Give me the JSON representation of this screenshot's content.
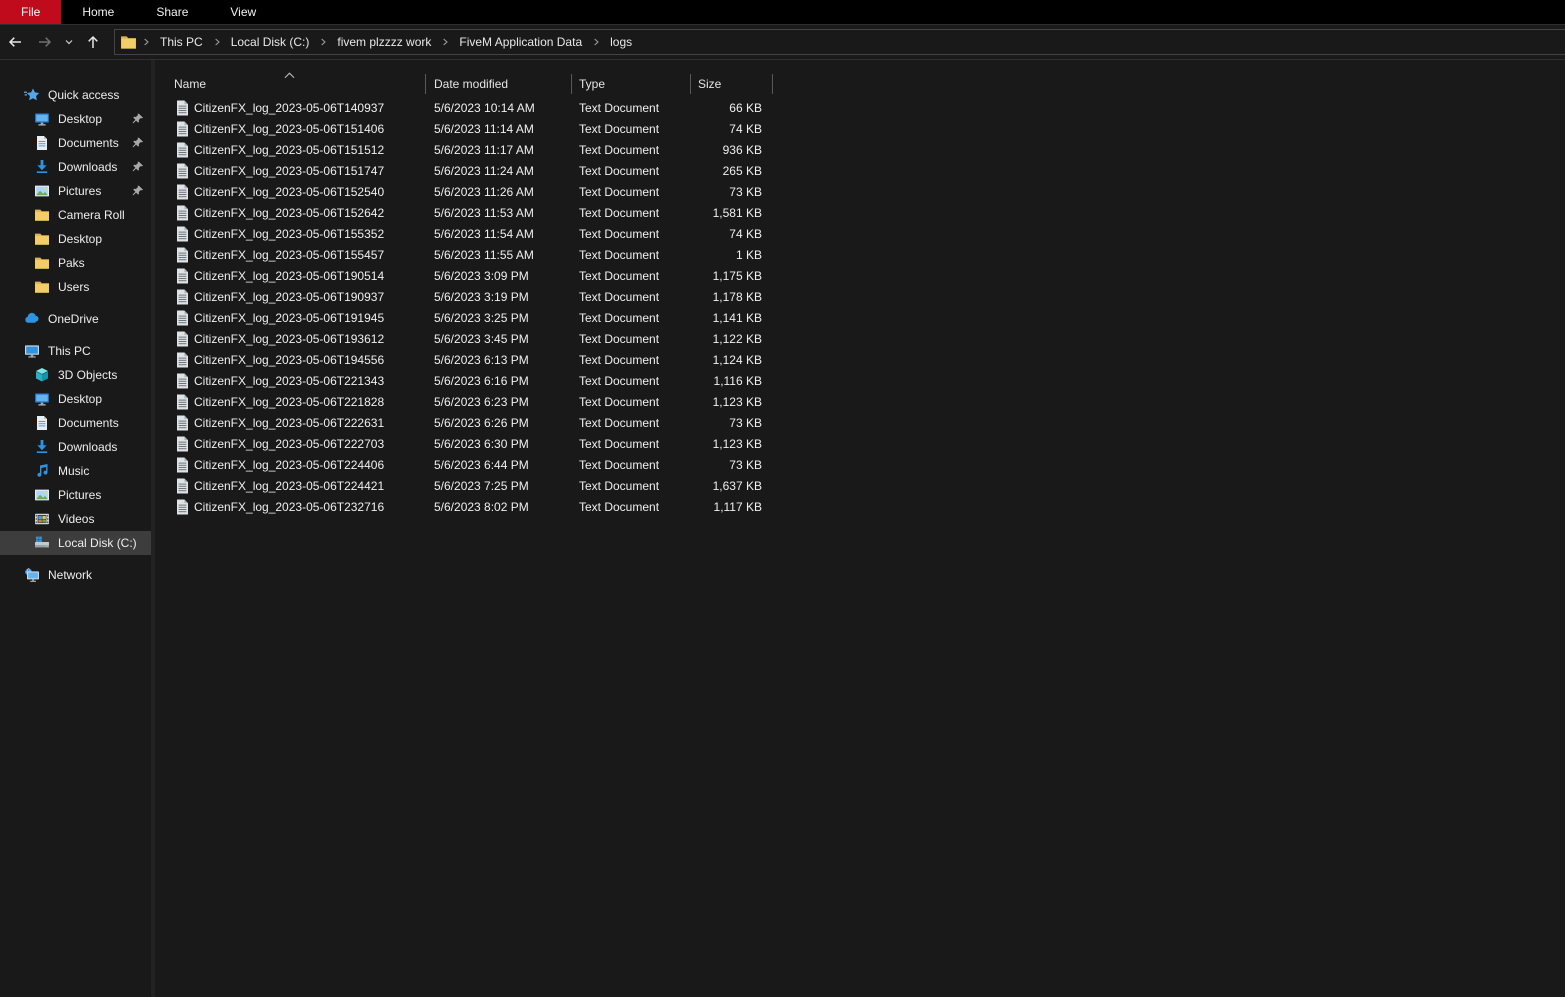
{
  "ribbon": {
    "tabs": [
      {
        "label": "File",
        "active": true
      },
      {
        "label": "Home",
        "active": false
      },
      {
        "label": "Share",
        "active": false
      },
      {
        "label": "View",
        "active": false
      }
    ]
  },
  "navbar": {
    "breadcrumb": [
      {
        "label": "This PC"
      },
      {
        "label": "Local Disk (C:)"
      },
      {
        "label": "fivem plzzzz work"
      },
      {
        "label": "FiveM Application Data"
      },
      {
        "label": "logs"
      }
    ]
  },
  "sidebar": {
    "items": [
      {
        "label": "Quick access",
        "icon": "quick-access",
        "level": 0,
        "pinned": false,
        "selected": false,
        "gap": false
      },
      {
        "label": "Desktop",
        "icon": "desktop",
        "level": 1,
        "pinned": true,
        "selected": false,
        "gap": false
      },
      {
        "label": "Documents",
        "icon": "documents",
        "level": 1,
        "pinned": true,
        "selected": false,
        "gap": false
      },
      {
        "label": "Downloads",
        "icon": "downloads",
        "level": 1,
        "pinned": true,
        "selected": false,
        "gap": false
      },
      {
        "label": "Pictures",
        "icon": "pictures",
        "level": 1,
        "pinned": true,
        "selected": false,
        "gap": false
      },
      {
        "label": "Camera Roll",
        "icon": "folder",
        "level": 1,
        "pinned": false,
        "selected": false,
        "gap": false
      },
      {
        "label": "Desktop",
        "icon": "folder",
        "level": 1,
        "pinned": false,
        "selected": false,
        "gap": false
      },
      {
        "label": "Paks",
        "icon": "folder",
        "level": 1,
        "pinned": false,
        "selected": false,
        "gap": false
      },
      {
        "label": "Users",
        "icon": "folder",
        "level": 1,
        "pinned": false,
        "selected": false,
        "gap": false
      },
      {
        "label": "OneDrive",
        "icon": "onedrive",
        "level": 0,
        "pinned": false,
        "selected": false,
        "gap": true
      },
      {
        "label": "This PC",
        "icon": "this-pc",
        "level": 0,
        "pinned": false,
        "selected": false,
        "gap": true
      },
      {
        "label": "3D Objects",
        "icon": "objects-3d",
        "level": 1,
        "pinned": false,
        "selected": false,
        "gap": false
      },
      {
        "label": "Desktop",
        "icon": "desktop",
        "level": 1,
        "pinned": false,
        "selected": false,
        "gap": false
      },
      {
        "label": "Documents",
        "icon": "documents",
        "level": 1,
        "pinned": false,
        "selected": false,
        "gap": false
      },
      {
        "label": "Downloads",
        "icon": "downloads",
        "level": 1,
        "pinned": false,
        "selected": false,
        "gap": false
      },
      {
        "label": "Music",
        "icon": "music",
        "level": 1,
        "pinned": false,
        "selected": false,
        "gap": false
      },
      {
        "label": "Pictures",
        "icon": "pictures",
        "level": 1,
        "pinned": false,
        "selected": false,
        "gap": false
      },
      {
        "label": "Videos",
        "icon": "videos",
        "level": 1,
        "pinned": false,
        "selected": false,
        "gap": false
      },
      {
        "label": "Local Disk (C:)",
        "icon": "local-disk",
        "level": 1,
        "pinned": false,
        "selected": true,
        "gap": false
      },
      {
        "label": "Network",
        "icon": "network",
        "level": 0,
        "pinned": false,
        "selected": false,
        "gap": true
      }
    ]
  },
  "table": {
    "columns": {
      "name": "Name",
      "date": "Date modified",
      "type": "Type",
      "size": "Size"
    },
    "sort": {
      "column": "Name",
      "direction": "ascending"
    },
    "rows": [
      {
        "name": "CitizenFX_log_2023-05-06T140937",
        "date": "5/6/2023 10:14 AM",
        "type": "Text Document",
        "size": "66 KB"
      },
      {
        "name": "CitizenFX_log_2023-05-06T151406",
        "date": "5/6/2023 11:14 AM",
        "type": "Text Document",
        "size": "74 KB"
      },
      {
        "name": "CitizenFX_log_2023-05-06T151512",
        "date": "5/6/2023 11:17 AM",
        "type": "Text Document",
        "size": "936 KB"
      },
      {
        "name": "CitizenFX_log_2023-05-06T151747",
        "date": "5/6/2023 11:24 AM",
        "type": "Text Document",
        "size": "265 KB"
      },
      {
        "name": "CitizenFX_log_2023-05-06T152540",
        "date": "5/6/2023 11:26 AM",
        "type": "Text Document",
        "size": "73 KB"
      },
      {
        "name": "CitizenFX_log_2023-05-06T152642",
        "date": "5/6/2023 11:53 AM",
        "type": "Text Document",
        "size": "1,581 KB"
      },
      {
        "name": "CitizenFX_log_2023-05-06T155352",
        "date": "5/6/2023 11:54 AM",
        "type": "Text Document",
        "size": "74 KB"
      },
      {
        "name": "CitizenFX_log_2023-05-06T155457",
        "date": "5/6/2023 11:55 AM",
        "type": "Text Document",
        "size": "1 KB"
      },
      {
        "name": "CitizenFX_log_2023-05-06T190514",
        "date": "5/6/2023 3:09 PM",
        "type": "Text Document",
        "size": "1,175 KB"
      },
      {
        "name": "CitizenFX_log_2023-05-06T190937",
        "date": "5/6/2023 3:19 PM",
        "type": "Text Document",
        "size": "1,178 KB"
      },
      {
        "name": "CitizenFX_log_2023-05-06T191945",
        "date": "5/6/2023 3:25 PM",
        "type": "Text Document",
        "size": "1,141 KB"
      },
      {
        "name": "CitizenFX_log_2023-05-06T193612",
        "date": "5/6/2023 3:45 PM",
        "type": "Text Document",
        "size": "1,122 KB"
      },
      {
        "name": "CitizenFX_log_2023-05-06T194556",
        "date": "5/6/2023 6:13 PM",
        "type": "Text Document",
        "size": "1,124 KB"
      },
      {
        "name": "CitizenFX_log_2023-05-06T221343",
        "date": "5/6/2023 6:16 PM",
        "type": "Text Document",
        "size": "1,116 KB"
      },
      {
        "name": "CitizenFX_log_2023-05-06T221828",
        "date": "5/6/2023 6:23 PM",
        "type": "Text Document",
        "size": "1,123 KB"
      },
      {
        "name": "CitizenFX_log_2023-05-06T222631",
        "date": "5/6/2023 6:26 PM",
        "type": "Text Document",
        "size": "73 KB"
      },
      {
        "name": "CitizenFX_log_2023-05-06T222703",
        "date": "5/6/2023 6:30 PM",
        "type": "Text Document",
        "size": "1,123 KB"
      },
      {
        "name": "CitizenFX_log_2023-05-06T224406",
        "date": "5/6/2023 6:44 PM",
        "type": "Text Document",
        "size": "73 KB"
      },
      {
        "name": "CitizenFX_log_2023-05-06T224421",
        "date": "5/6/2023 7:25 PM",
        "type": "Text Document",
        "size": "1,637 KB"
      },
      {
        "name": "CitizenFX_log_2023-05-06T232716",
        "date": "5/6/2023 8:02 PM",
        "type": "Text Document",
        "size": "1,117 KB"
      }
    ]
  },
  "colors": {
    "file_tab_red": "#c00b1c",
    "window_bg": "#191919",
    "ribbon_bg": "#000000",
    "selection_gray": "#3d3d3d",
    "accent_blue": "#2e93e0",
    "folder_yellow": "#f3cd68"
  }
}
